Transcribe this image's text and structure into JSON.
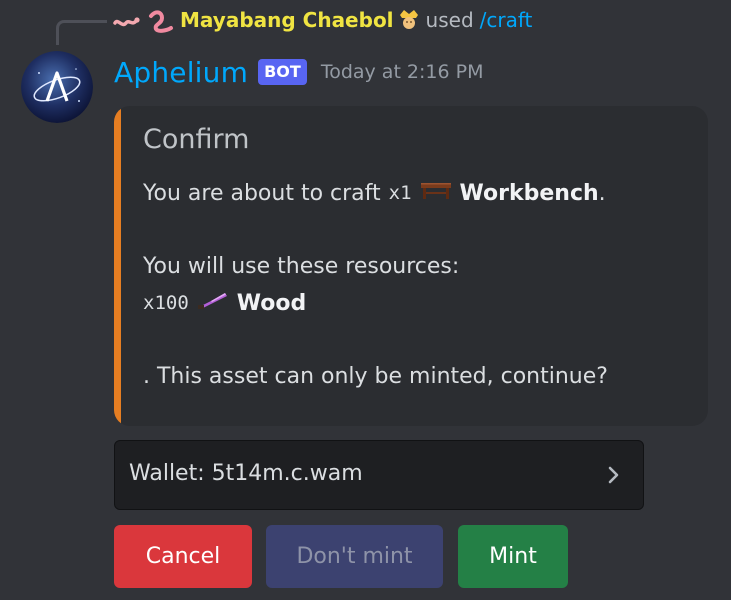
{
  "reply": {
    "username": "Mayabang Chaebol",
    "used_text": "used",
    "command": "/craft",
    "worm_icon": "worm-icon",
    "crown_icon": "crown-icon"
  },
  "message": {
    "author": "Aphelium",
    "bot_tag": "BOT",
    "timestamp": "Today at 2:16 PM"
  },
  "embed": {
    "accent_color": "#e67e22",
    "title": "Confirm",
    "line1_prefix": "You are about to craft",
    "line1_qty": "x1",
    "line1_item": "Workbench",
    "line1_suffix": ".",
    "line2": "You will use these resources:",
    "resource_qty": "x100",
    "resource_item": "Wood",
    "line3": ". This asset can only be minted, continue?"
  },
  "wallet_select": {
    "value": "Wallet: 5t14m.c.wam"
  },
  "buttons": {
    "cancel": "Cancel",
    "dont_mint": "Don't mint",
    "mint": "Mint"
  },
  "colors": {
    "background": "#313338",
    "embed_bg": "#2b2d31",
    "link_blue": "#00a8fc",
    "bot_tag": "#5865f2",
    "danger": "#da373c",
    "success": "#248046",
    "disabled": "#3c4270"
  }
}
